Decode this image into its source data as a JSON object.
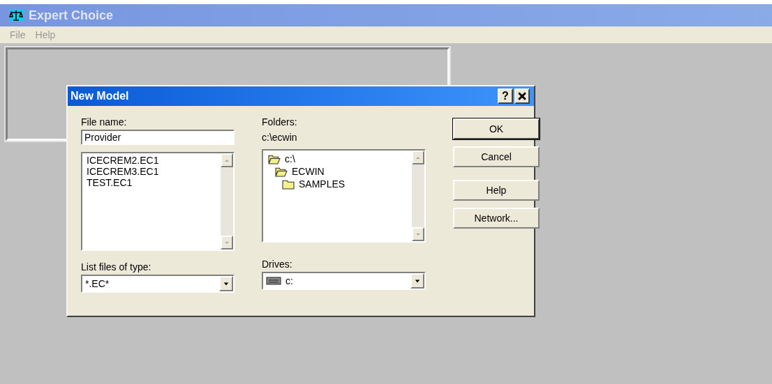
{
  "window": {
    "title": "Expert Choice"
  },
  "menu": [
    {
      "label": "File",
      "disabled": true
    },
    {
      "label": "Help",
      "disabled": true
    }
  ],
  "dialog": {
    "title": "New Model",
    "file_name": {
      "label": "File name:",
      "value": "Provider"
    },
    "files": [
      {
        "name": "ICECREM2.EC1",
        "selected": false
      },
      {
        "name": "ICECREM3.EC1",
        "selected": false
      },
      {
        "name": "TEST.EC1",
        "selected": false
      }
    ],
    "file_type": {
      "label": "List files of type:",
      "value": "*.EC*"
    },
    "folders": {
      "label": "Folders:",
      "path": "c:\\ecwin",
      "tree": [
        {
          "name": "c:\\",
          "children": [
            {
              "name": "ECWIN",
              "children": [
                {
                  "name": "SAMPLES"
                }
              ]
            }
          ]
        }
      ]
    },
    "drives": {
      "label": "Drives:",
      "value": "c:"
    },
    "buttons": [
      {
        "label": "OK",
        "default": true
      },
      {
        "label": "Cancel",
        "default": false
      },
      {
        "label": "Help",
        "default": false
      },
      {
        "label": "Network...",
        "default": false
      }
    ],
    "title_buttons": [
      "?"
    ]
  }
}
